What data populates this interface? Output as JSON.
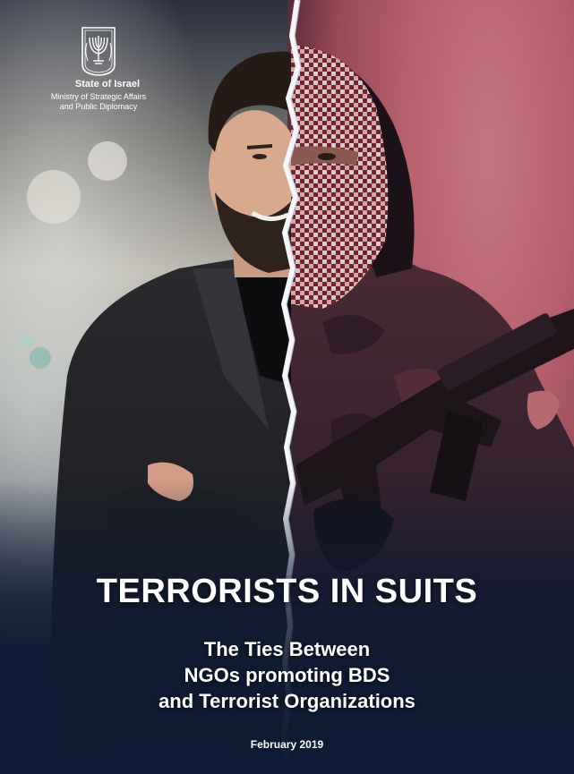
{
  "header": {
    "emblem_icon": "menorah-emblem-icon",
    "state_name": "State of Israel",
    "ministry_line1": "Ministry of Strategic Affairs",
    "ministry_line2": "and Public Diplomacy"
  },
  "cover": {
    "title": "TERRORISTS IN SUITS",
    "subtitle_line1": "The Ties Between",
    "subtitle_line2": "NGOs promoting BDS",
    "subtitle_line3": "and Terrorist Organizations",
    "date": "February 2019"
  },
  "colors": {
    "background_navy": "#0e1a33",
    "right_tint": "#b5606c",
    "text": "#ffffff"
  }
}
